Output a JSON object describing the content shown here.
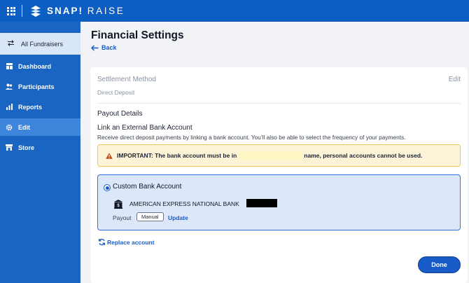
{
  "app": {
    "brand_bold": "SNAP!",
    "brand_light": "RAISE",
    "icons": {
      "apps": "grid-apps-icon",
      "logo": "snap-logo-icon"
    }
  },
  "sidebar": {
    "all_fundraisers": {
      "label": "All Fundraisers",
      "icon": "swap-arrows-icon"
    },
    "items": [
      {
        "label": "Dashboard",
        "icon": "dashboard-icon",
        "active": false
      },
      {
        "label": "Participants",
        "icon": "participants-icon",
        "active": false
      },
      {
        "label": "Reports",
        "icon": "bar-chart-icon",
        "active": false
      },
      {
        "label": "Edit",
        "icon": "gear-icon",
        "active": true
      },
      {
        "label": "Store",
        "icon": "store-icon",
        "active": false
      }
    ]
  },
  "main": {
    "title": "Financial Settings",
    "back_label": "Back",
    "settlement": {
      "label": "Settlement Method",
      "edit_label": "Edit",
      "value": "Direct Deposit"
    },
    "payout_details_label": "Payout Details",
    "link_title": "Link an External Bank Account",
    "link_description": "Receive direct deposit payments by linking a bank account. You’ll also be able to select the frequency of your payments.",
    "alert": {
      "prefix": "IMPORTANT: The bank account must be in",
      "suffix": "name, personal accounts cannot be used."
    },
    "bank": {
      "type_label": "Custom Bank Account",
      "selected": true,
      "name": "AMERICAN EXPRESS NATIONAL BANK",
      "payout_label": "Payout",
      "payout_badge": "Manual",
      "update_label": "Update"
    },
    "replace_label": "Replace account",
    "done_label": "Done"
  },
  "colors": {
    "topbar": "#0d5ec2",
    "sidebar": "#1a64c2",
    "sidebar_active": "#3d84db",
    "accent": "#1a5cc7",
    "alert_bg": "#fdf4d8",
    "alert_border": "#ecc55e",
    "bank_box_bg": "#dce7f9"
  }
}
